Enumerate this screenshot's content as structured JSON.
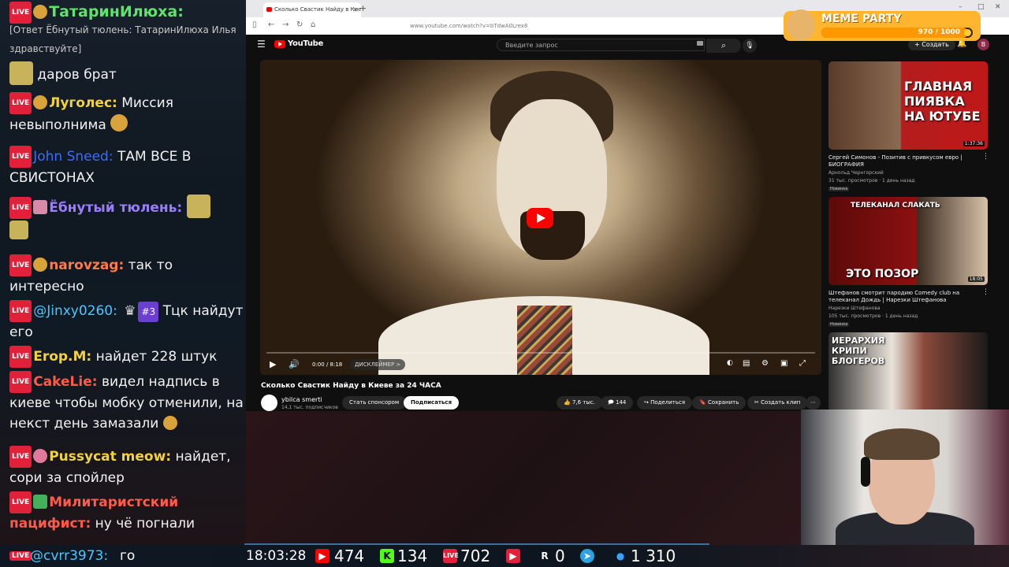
{
  "chat": {
    "messages": [
      {
        "nick": "ТатаринИлюха:",
        "nick_color": "#5fe36a",
        "text": ""
      },
      {
        "quote": "[Ответ Ёбнутый тюлень: ТатаринИлюха Илья здравствуйте]"
      },
      {
        "text": "даров брат"
      },
      {
        "nick": "Луголес:",
        "nick_color": "#f4d23a",
        "text": "Миссия невыполнима"
      },
      {
        "nick": "John Sneed:",
        "nick_color": "#3b6cff",
        "text": "ТАМ ВСЕ В СВИСТОНАХ"
      },
      {
        "nick": "Ёбнутый тюлень:",
        "nick_color": "#9a7cff",
        "text": ""
      },
      {
        "nick": "narovzag:",
        "nick_color": "#ff7a4a",
        "text": "так то интересно"
      },
      {
        "nick": "@Jinxy0260:",
        "nick_color": "#46c9ff",
        "badge": "#3",
        "text": "Тцк найдут его"
      },
      {
        "nick": "Erop.M:",
        "nick_color": "#f4d23a",
        "text": "найдет 228 штук"
      },
      {
        "nick": "CakeLie:",
        "nick_color": "#ff5a4a",
        "text": "видел надпись в киеве чтобы мобку отменили, на некст день замазали"
      },
      {
        "nick": "Pussycat meow:",
        "nick_color": "#f4d23a",
        "text": "найдет, сори за спойлер"
      },
      {
        "nick": "Милитаристский пацифист:",
        "nick_color": "#ff5a4a",
        "text": "ну чё погнали"
      },
      {
        "nick": "@cvrr3973:",
        "nick_color": "#46c9ff",
        "text": "го"
      }
    ],
    "live_label": "LIVE"
  },
  "browser": {
    "tab_title": "Сколько Свастик Найду в Киеве",
    "url": "www.youtube.com/watch?v=bTdwA0Lrex8",
    "youtube_logo": "YouTube",
    "search_placeholder": "Введите запрос",
    "create_label": "+ Создать",
    "avatar_letter": "B"
  },
  "video": {
    "time": "0:00 / 8:18",
    "chapter": "ДИСКЛЕЙМЕР >",
    "title": "Сколько Свастик Найду в Киеве за 24 ЧАСА",
    "channel": "ybilca smerti",
    "subscribers": "14,1 тыс. подписчиков",
    "sponsor_btn": "Стать спонсором",
    "subscribe_btn": "Подписаться",
    "likes": "7,6 тыс.",
    "comments": "144",
    "share": "Поделиться",
    "save": "Сохранить",
    "clip": "Создать клип",
    "progress_fraction": 0.0
  },
  "recommendations": [
    {
      "thumb_text": "ГЛАВНАЯ ПИЯВКА НА ЮТУБЕ",
      "duration": "1:37:36",
      "title": "Сергей Симонов - Позитив с привкусом евро | БИОГРАФИЯ",
      "channel": "Арнольд Чернгорский",
      "meta": "31 тыс. просмотров · 1 день назад",
      "badge": "Новинка"
    },
    {
      "thumb_text": "ЭТО ПОЗОР",
      "thumb_sub": "ТЕЛЕКАНАЛ СЛАКАТЬ",
      "duration": "18:05",
      "title": "Штефанов смотрит пародию Comedy club на телеканал Дождь | Нарезки Штефанова",
      "channel": "Нарезки Штефанова",
      "meta": "105 тыс. просмотров · 1 день назад",
      "badge": "Новинка"
    },
    {
      "thumb_text": "ИЕРАРХИЯ КРИПИ БЛОГЕРОВ"
    }
  ],
  "meme_party": {
    "title": "MEME PARTY",
    "count": "970 / 1000",
    "fill_fraction": 0.97
  },
  "statbar": {
    "clock": "18:03:28",
    "youtube_viewers": "474",
    "kick_viewers": "134",
    "vk_live_viewers": "702",
    "rutube_viewers": "0",
    "telegram_viewers": "1 310",
    "icons": {
      "youtube": "youtube-icon",
      "kick": "kick-icon",
      "vk": "vk-live-icon",
      "rutube": "rutube-icon",
      "telegram": "telegram-icon",
      "user": "user-icon"
    },
    "colors": {
      "youtube": "#ff0000",
      "kick": "#53fc18",
      "vk": "#e1213a",
      "rutube": "#ffffff",
      "telegram": "#2aa3e0",
      "user": "#3aa0ff"
    }
  }
}
